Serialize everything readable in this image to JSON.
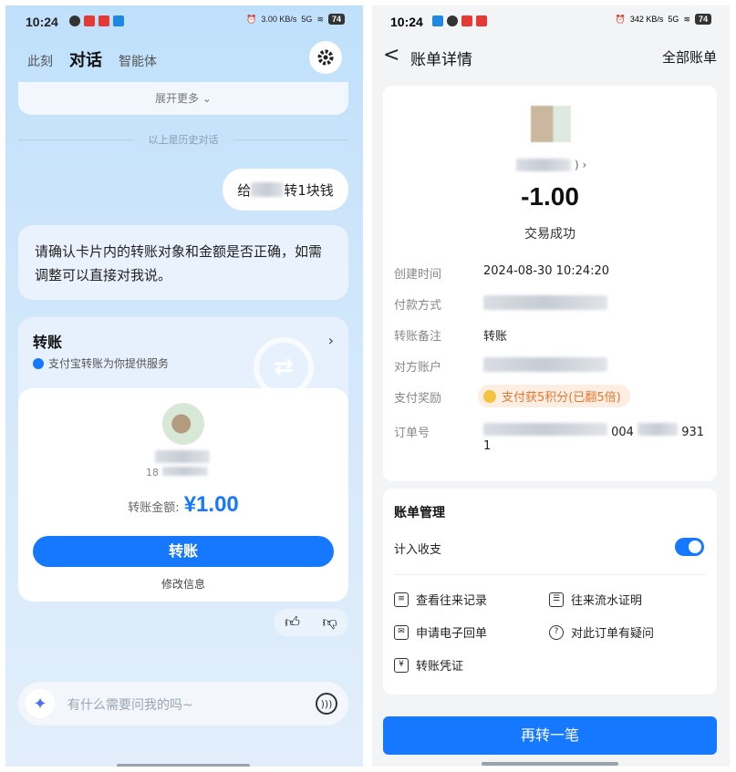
{
  "left": {
    "status_bar": {
      "time": "10:24",
      "net": "3.00 KB/s",
      "signal": "5G",
      "battery": "74"
    },
    "tabs": [
      "此刻",
      "对话",
      "智能体"
    ],
    "expand_more": "展开更多",
    "history_divider": "以上是历史对话",
    "user_message_prefix": "给",
    "user_message_suffix": "转1块钱",
    "assistant_message": "请确认卡片内的转账对象和金额是否正确，如需调整可以直接对我说。",
    "transfer_card": {
      "title": "转账",
      "subtitle": "支付宝转账为你提供服务",
      "recipient_phone_partial": "18",
      "amount_label": "转账金额:",
      "amount": "¥1.00",
      "button": "转账",
      "modify": "修改信息"
    },
    "input_placeholder": "有什么需要问我的吗~"
  },
  "right": {
    "status_bar": {
      "time": "10:24",
      "net": "342 KB/s",
      "signal": "5G",
      "battery": "74"
    },
    "nav": {
      "back": "<",
      "title": "账单详情",
      "all_bills": "全部账单"
    },
    "amount": "-1.00",
    "status": "交易成功",
    "details": [
      {
        "key": "创建时间",
        "value": "2024-08-30 10:24:20"
      },
      {
        "key": "付款方式",
        "value": ""
      },
      {
        "key": "转账备注",
        "value": "转账"
      },
      {
        "key": "对方账户",
        "value": ""
      },
      {
        "key": "支付奖励",
        "value": "支付获5积分(已翻5倍)"
      },
      {
        "key": "订单号",
        "value": "1",
        "partial_a": "004",
        "partial_b": "931"
      }
    ],
    "management": {
      "title": "账单管理",
      "include_label": "计入收支",
      "include_enabled": true,
      "actions": [
        "查看往来记录",
        "往来流水证明",
        "申请电子回单",
        "对此订单有疑问",
        "转账凭证"
      ]
    },
    "again_button": "再转一笔"
  },
  "colors": {
    "accent": "#1677ff",
    "reward": "#e6772e"
  }
}
